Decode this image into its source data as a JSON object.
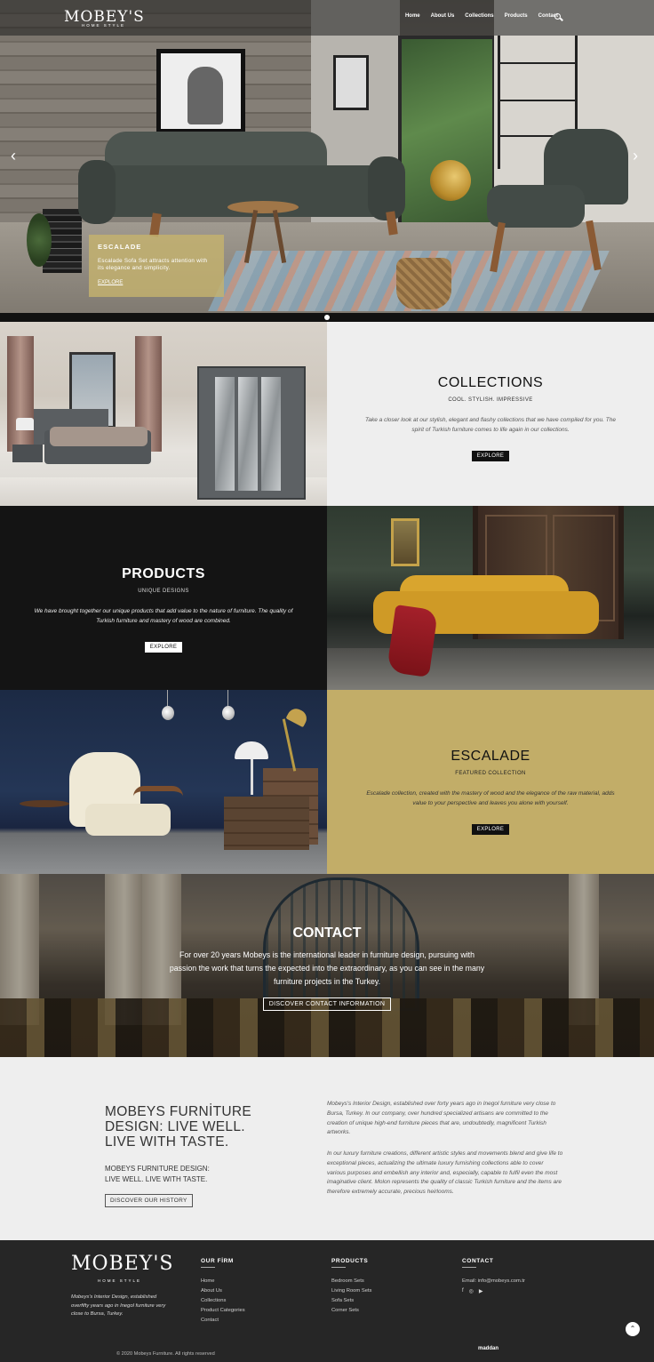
{
  "brand": {
    "logo": "MOBEY'S",
    "logo_sub": "HOME STYLE"
  },
  "nav": {
    "items": [
      "Home",
      "About Us",
      "Collections",
      "Products",
      "Contact"
    ]
  },
  "hero": {
    "arrow_prev": "‹",
    "arrow_next": "›",
    "caption_title": "ESCALADE",
    "caption_text": "Escalade Sofa Set attracts attention with its elegance and simplicity.",
    "caption_link": "EXPLORE"
  },
  "collections": {
    "title": "COLLECTIONS",
    "subtitle": "COOL. STYLISH. IMPRESSIVE",
    "description": "Take a closer look at our stylish, elegant and flashy collections that we have compiled for you. The spirit of Turkish furniture comes to life again in our collections.",
    "button": "EXPLORE"
  },
  "products": {
    "title": "PRODUCTS",
    "subtitle": "UNIQUE DESIGNS",
    "description": "We have brought together our unique products that add value to the nature of furniture. The quality of Turkish furniture and mastery of wood are combined.",
    "button": "EXPLORE"
  },
  "escalade": {
    "title": "ESCALADE",
    "subtitle": "FEATURED COLLECTION",
    "description": "Escalade collection, created with the mastery of wood and the elegance of the raw material, adds value to your perspective and leaves you alone with yourself.",
    "button": "EXPLORE"
  },
  "contact": {
    "title": "CONTACT",
    "text": "For over 20 years Mobeys is the international leader in furniture design, pursuing with passion the work that turns the expected into the extraordinary, as you can see in the many furniture projects in the Turkey.",
    "button": "DISCOVER CONTACT INFORMATION"
  },
  "about": {
    "headline": [
      "MOBEYS FURNİTURE",
      "DESIGN: LIVE WELL.",
      "LIVE WITH TASTE."
    ],
    "tagline": [
      "MOBEYS FURNITURE DESIGN:",
      "LIVE WELL. LIVE WITH TASTE."
    ],
    "button": "DISCOVER OUR HISTORY",
    "paragraph1": "Mobeys's Interior Design, established over forty years ago in Inegol furniture very close to Bursa, Turkey. In our company, over hundred specialized artisans are committed to the creation of unique high-end furniture pieces that are, undoubtedly, magnificent Turkish artworks.",
    "paragraph2": "In our luxury furniture creations, different artistic styles and movements blend and give life to exceptional pieces, actualizing the ultimate luxury furnishing collections able to cover various purposes and embellish any interior and, especially, capable to fulfil even the most imaginative client. Molon represents the quality of classic Turkish furniture and the items are therefore extremely accurate, precious heirlooms."
  },
  "footer": {
    "logo": "MOBEY'S",
    "logo_sub": "HOME STYLE",
    "about": "Mobeys's Interior Design, established overfifty years ago in Inegol furniture very close to Bursa, Turkey.",
    "firm_title": "OUR FİRM",
    "firm_links": [
      "Home",
      "About Us",
      "Collections",
      "Product Categories",
      "Contact"
    ],
    "products_title": "PRODUCTS",
    "products_links": [
      "Bedroom Sets",
      "Living Room Sets",
      "Sofa Sets",
      "Corner Sets"
    ],
    "contact_title": "CONTACT",
    "email": "Email: info@mobeys.com.tr",
    "social": [
      "f",
      "◎",
      "▶"
    ],
    "to_top": "⌃",
    "copyright": "© 2020 Mobeys Furniture. All rights reserved",
    "credit": "maddan"
  }
}
